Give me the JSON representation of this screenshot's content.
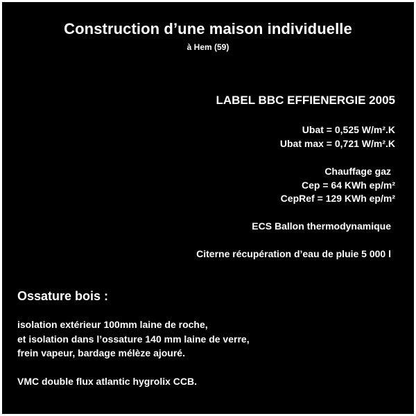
{
  "title": "Construction d’une maison individuelle",
  "subtitle": "à Hem (59)",
  "label_heading": "LABEL BBC EFFIENERGIE 2005",
  "ubat": "Ubat = 0,525 W/m².K",
  "ubat_max": "Ubat max = 0,721 W/m².K",
  "chauffage": "Chauffage gaz",
  "cep": "Cep = 64 KWh ep/m²",
  "cepref": "CepRef = 129 KWh ep/m²",
  "ecs": "ECS Ballon thermodynamique",
  "citerne": "Citerne récupération d’eau de pluie 5 000 l",
  "ossature_title": "Ossature bois :",
  "isolation_lines": [
    "isolation extérieur 100mm laine de roche,",
    "et isolation dans l’ossature 140 mm laine de verre,",
    "frein vapeur, bardage mélèze ajouré."
  ],
  "vmc": "VMC double flux atlantic hygrolix CCB."
}
